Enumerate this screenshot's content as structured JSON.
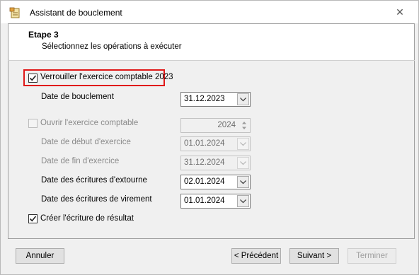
{
  "window": {
    "title": "Assistant de bouclement",
    "close_glyph": "✕"
  },
  "header": {
    "step": "Etape 3",
    "subtitle": "Sélectionnez les opérations à exécuter"
  },
  "lock_year": {
    "label": "Verrouiller l'exercice comptable 2023",
    "checked": true
  },
  "closing_date": {
    "label": "Date de bouclement",
    "value": "31.12.2023"
  },
  "open_year": {
    "label": "Ouvrir l'exercice comptable",
    "checked": false,
    "year_value": "2024"
  },
  "start_date": {
    "label": "Date de début d'exercice",
    "value": "01.01.2024"
  },
  "end_date": {
    "label": "Date de fin d'exercice",
    "value": "31.12.2024"
  },
  "reversal_date": {
    "label": "Date des écritures d'extourne",
    "value": "02.01.2024"
  },
  "transfer_date": {
    "label": "Date des écritures de virement",
    "value": "01.01.2024"
  },
  "result_entry": {
    "label": "Créer l'écriture de résultat",
    "checked": true
  },
  "buttons": {
    "cancel": "Annuler",
    "previous": "< Précédent",
    "next": "Suivant >",
    "finish": "Terminer"
  },
  "colors": {
    "highlight": "#e01818",
    "window_bg": "#f0f0f0"
  }
}
